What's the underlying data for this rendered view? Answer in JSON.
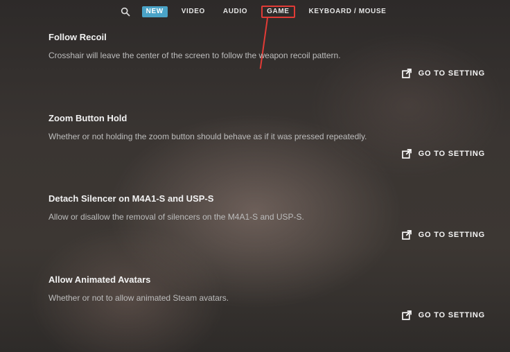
{
  "topbar": {
    "tabs": [
      {
        "id": "new",
        "label": "NEW"
      },
      {
        "id": "video",
        "label": "VIDEO"
      },
      {
        "id": "audio",
        "label": "AUDIO"
      },
      {
        "id": "game",
        "label": "GAME"
      },
      {
        "id": "keyboardmouse",
        "label": "KEYBOARD / MOUSE"
      }
    ],
    "highlighted_tab": "game",
    "new_badge_tab": "new"
  },
  "go_to_setting_label": "GO TO SETTING",
  "settings": [
    {
      "id": "follow-recoil",
      "title": "Follow Recoil",
      "description": "Crosshair will leave the center of the screen to follow the weapon recoil pattern."
    },
    {
      "id": "zoom-button-hold",
      "title": "Zoom Button Hold",
      "description": "Whether or not holding the zoom button should behave as if it was pressed repeatedly."
    },
    {
      "id": "detach-silencer",
      "title": "Detach Silencer on M4A1-S and USP-S",
      "description": "Allow or disallow the removal of silencers on the M4A1-S and USP-S."
    },
    {
      "id": "allow-animated-avatars",
      "title": "Allow Animated Avatars",
      "description": "Whether or not to allow animated Steam avatars."
    }
  ]
}
